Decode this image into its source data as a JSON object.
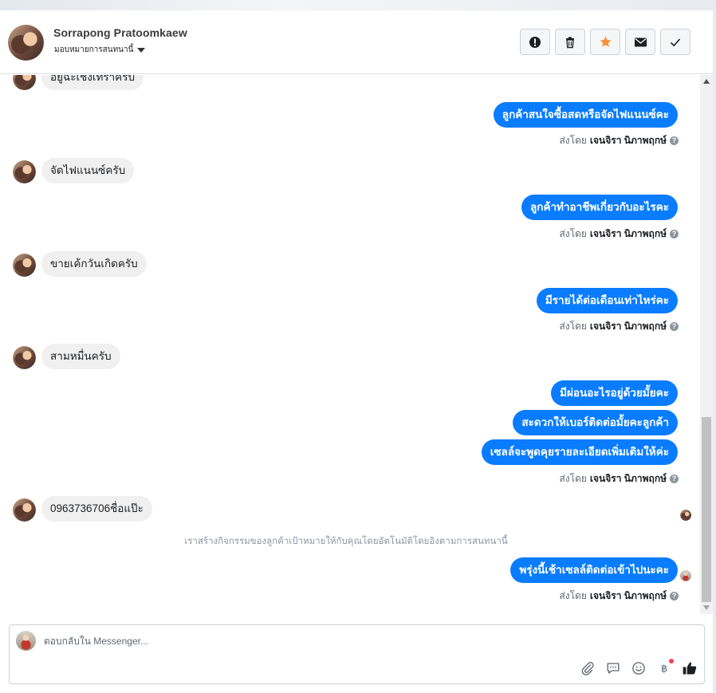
{
  "header": {
    "name": "Sorrapong Pratoomkaew",
    "assign_label": "มอบหมายการสนทนานี้",
    "actions": [
      {
        "icon": "alert-icon"
      },
      {
        "icon": "trash-icon"
      },
      {
        "icon": "star-icon",
        "color": "#f7923a"
      },
      {
        "icon": "mail-icon"
      },
      {
        "icon": "check-icon"
      }
    ]
  },
  "messages": {
    "partial_incoming": "อยู่ฉะเชิงเทราครับ",
    "items": [
      {
        "type": "out",
        "text": "ลูกค้าสนใจซื้อสดหรือจัดไฟแนนซ์คะ"
      },
      {
        "type": "sent_by",
        "prefix": "ส่งโดย",
        "agent": "เจนจิรา นิภาพฤกษ์"
      },
      {
        "type": "in",
        "text": "จัดไฟแนนซ์ครับ"
      },
      {
        "type": "out",
        "text": "ลูกค้าทำอาชีพเกี่ยวกับอะไรคะ"
      },
      {
        "type": "sent_by",
        "prefix": "ส่งโดย",
        "agent": "เจนจิรา นิภาพฤกษ์"
      },
      {
        "type": "in",
        "text": "ขายเค้กวันเกิดครับ"
      },
      {
        "type": "out",
        "text": "มีรายได้ต่อเดือนเท่าไหร่คะ"
      },
      {
        "type": "sent_by",
        "prefix": "ส่งโดย",
        "agent": "เจนจิรา นิภาพฤกษ์"
      },
      {
        "type": "in",
        "text": "สามหมื่นครับ"
      },
      {
        "type": "out",
        "text": "มีผ่อนอะไรอยู่ด้วยมั้ยคะ"
      },
      {
        "type": "out",
        "text": "สะดวกให้เบอร์ติดต่อมั้ยคะลูกค้า"
      },
      {
        "type": "out",
        "text": "เซลล์จะพูดคุยรายละเอียดเพิ่มเติมให้ค่ะ"
      },
      {
        "type": "sent_by",
        "prefix": "ส่งโดย",
        "agent": "เจนจิรา นิภาพฤกษ์"
      },
      {
        "type": "in",
        "text": "0963736706ชื่อแป๊ะ"
      },
      {
        "type": "system",
        "text": "เราสร้างกิจกรรมของลูกค้าเป้าหมายให้กับคุณโดยอัตโนมัติโดยอิงตามการสนทนานี้"
      },
      {
        "type": "out",
        "text": "พรุ่งนี้เช้าเซลล์ติดต่อเข้าไปนะคะ"
      },
      {
        "type": "sent_by",
        "prefix": "ส่งโดย",
        "agent": "เจนจิรา นิภาพฤกษ์"
      }
    ]
  },
  "composer": {
    "placeholder": "ตอบกลับใน Messenger...",
    "tools": [
      "paperclip-icon",
      "saved-reply-icon",
      "emoji-icon",
      "baht-icon",
      "thumbs-up-icon"
    ],
    "accent": "#0a7cff"
  }
}
